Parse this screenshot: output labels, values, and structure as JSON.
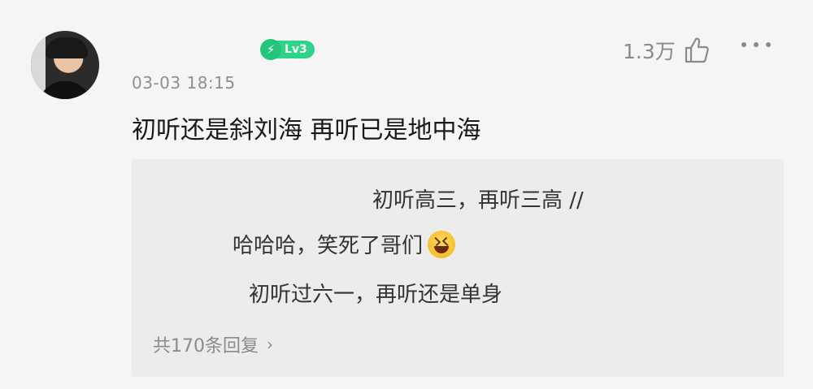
{
  "comment": {
    "level": "Lv3",
    "timestamp": "03-03 18:15",
    "likes": "1.3万",
    "text": "初听还是斜刘海 再听已是地中海"
  },
  "replies": [
    {
      "text": "初听高三，再听三高 //"
    },
    {
      "text": "哈哈哈，笑死了哥们"
    },
    {
      "text": "初听过六一，再听还是单身"
    }
  ],
  "reply_footer": {
    "label": "共170条回复"
  },
  "icons": {
    "like": "thumbs-up-icon",
    "more": "more-dots-icon",
    "level": "lightning-icon",
    "expand": "chevron-right-icon",
    "emoji": "laughing-emoji-icon"
  },
  "colors": {
    "level_badge": "#2fd38a",
    "reply_bg": "#ececec",
    "muted_text": "#8a8a8a"
  }
}
